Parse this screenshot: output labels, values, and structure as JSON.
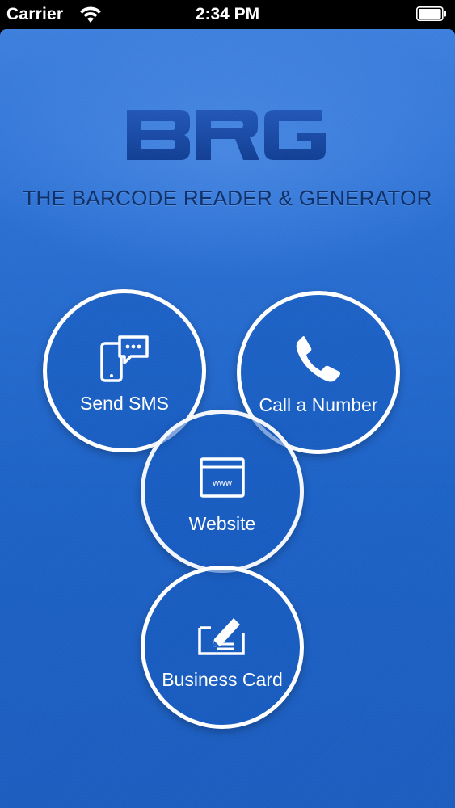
{
  "status_bar": {
    "carrier": "Carrier",
    "time": "2:34 PM"
  },
  "app": {
    "logo_text": "BRG",
    "tagline": "THE BARCODE READER & GENERATOR"
  },
  "actions": [
    {
      "label": "Send SMS",
      "icon": "sms-icon"
    },
    {
      "label": "Call a Number",
      "icon": "phone-icon"
    },
    {
      "label": "Website",
      "icon": "browser-icon",
      "icon_text": "www"
    },
    {
      "label": "Business Card",
      "icon": "business-card-icon"
    }
  ],
  "colors": {
    "background": "#1f63c8",
    "logo": "#1a4aa8",
    "tagline": "#0f2f66",
    "circle_border": "#ffffff"
  }
}
